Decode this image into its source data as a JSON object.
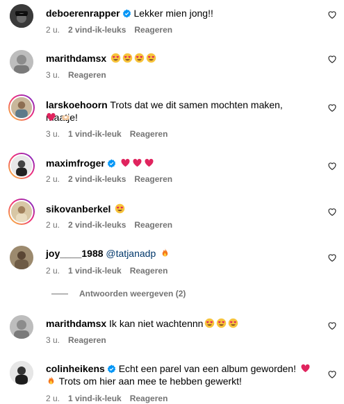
{
  "comments": [
    {
      "user": "deboerenrapper",
      "verified": true,
      "text": "Lekker mien jong!!",
      "time": "2 u.",
      "likes": "2 vind-ik-leuks",
      "reply": "Reageren"
    },
    {
      "user": "marithdamsx",
      "verified": false,
      "text": "",
      "time": "3 u.",
      "likes": "",
      "reply": "Reageren"
    },
    {
      "user": "larskoehoorn",
      "verified": false,
      "text": "Trots dat we dit samen mochten maken, maatje!",
      "time": "3 u.",
      "likes": "1 vind-ik-leuk",
      "reply": "Reageren"
    },
    {
      "user": "maximfroger",
      "verified": true,
      "text": "",
      "time": "2 u.",
      "likes": "2 vind-ik-leuks",
      "reply": "Reageren"
    },
    {
      "user": "sikovanberkel",
      "verified": false,
      "text": "",
      "time": "2 u.",
      "likes": "2 vind-ik-leuks",
      "reply": "Reageren"
    },
    {
      "user": "joy____1988",
      "verified": false,
      "mention": "@tatjanadp",
      "text": "",
      "time": "2 u.",
      "likes": "1 vind-ik-leuk",
      "reply": "Reageren"
    },
    {
      "user": "marithdamsx",
      "verified": false,
      "text": "Ik kan niet wachtennn",
      "time": "3 u.",
      "likes": "",
      "reply": "Reageren"
    },
    {
      "user": "colinheikens",
      "verified": true,
      "text": "Echt een parel van een album geworden!",
      "text2": "Trots om hier aan mee te hebben gewerkt!",
      "time": "2 u.",
      "likes": "1 vind-ik-leuk",
      "reply": "Reageren"
    }
  ],
  "view_replies": "Antwoorden weergeven (2)",
  "icons": {
    "like": "heart-outline-icon",
    "verified": "verified-badge-icon"
  },
  "colors": {
    "verified": "#0095f6",
    "mention": "#00376b",
    "meta": "#737373"
  }
}
